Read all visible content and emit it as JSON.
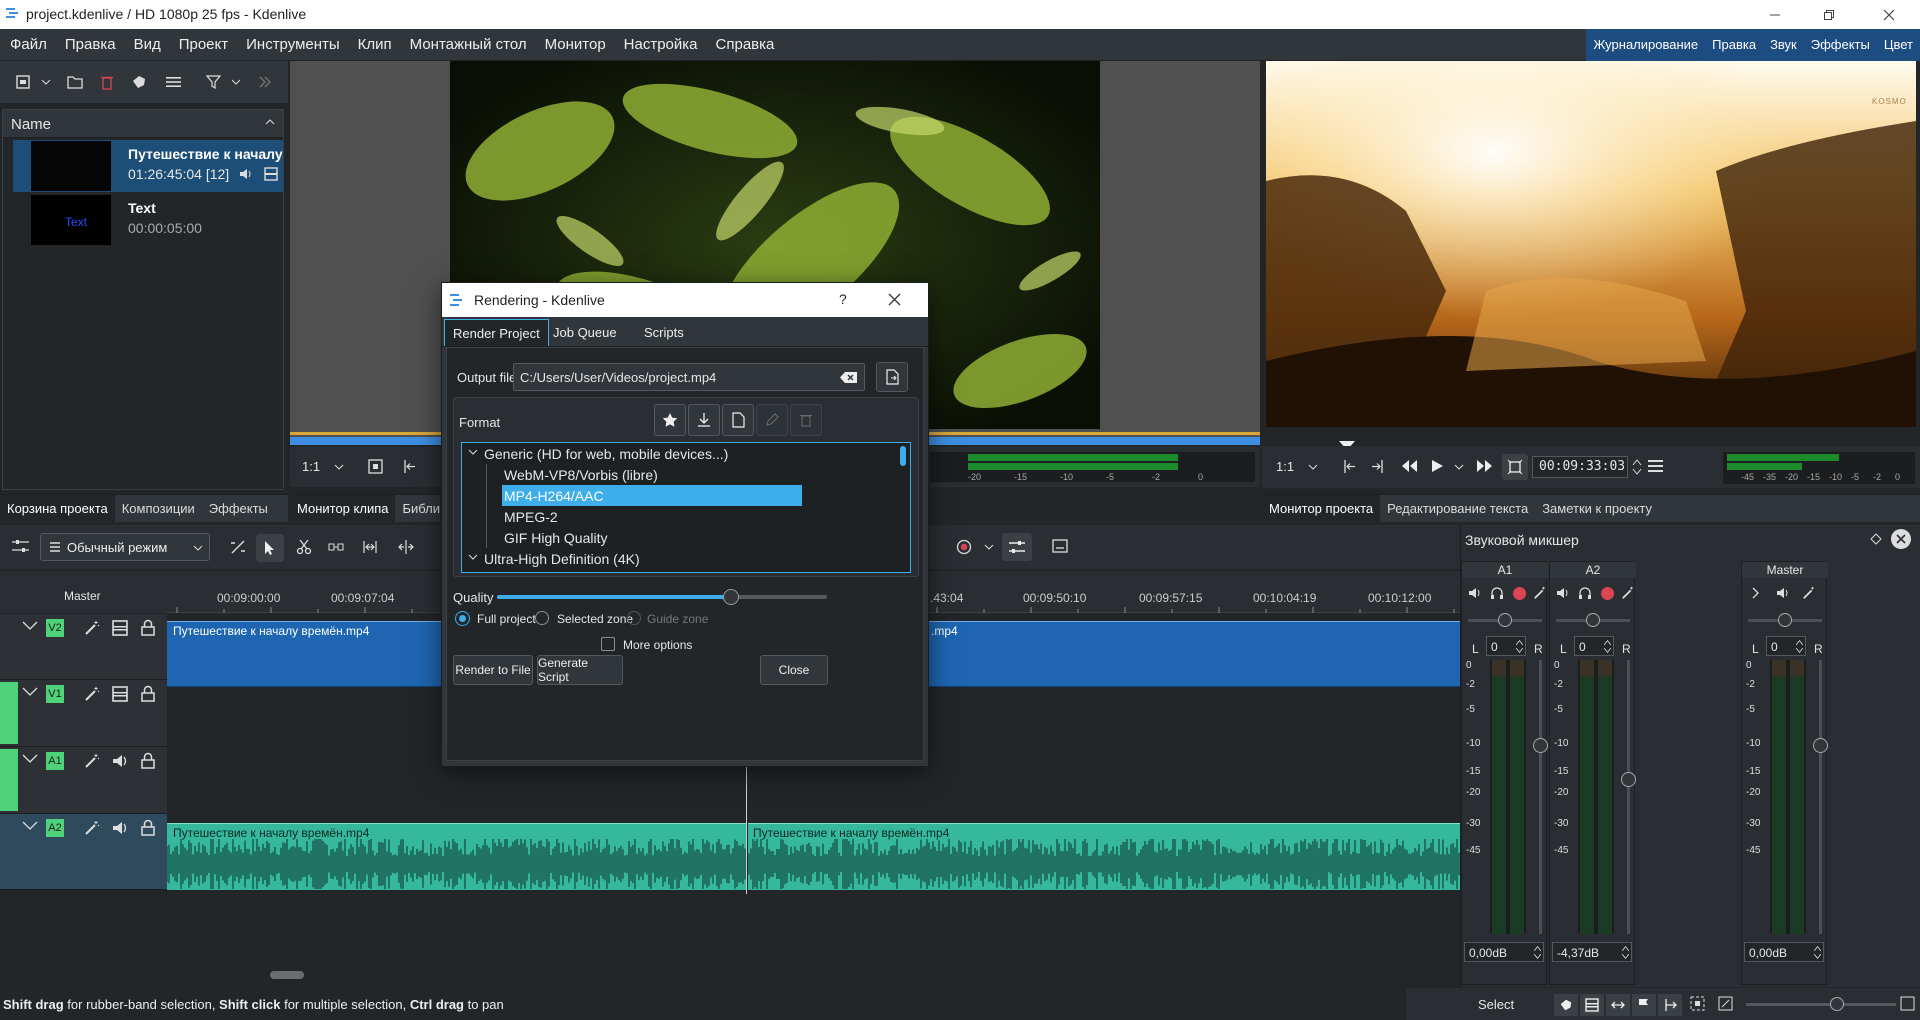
{
  "window": {
    "title": "project.kdenlive / HD 1080p 25 fps - Kdenlive"
  },
  "menu": [
    "Файл",
    "Правка",
    "Вид",
    "Проект",
    "Инструменты",
    "Клип",
    "Монтажный стол",
    "Монитор",
    "Настройка",
    "Справка"
  ],
  "layouts": [
    "Журналирование",
    "Правка",
    "Звук",
    "Эффекты",
    "Цвет"
  ],
  "bin": {
    "header": "Name",
    "items": [
      {
        "title": "Путешествие к началу",
        "meta": "01:26:45:04 [12]"
      },
      {
        "title": "Text",
        "meta": "00:00:05:00",
        "thumb_text": "Text"
      }
    ],
    "tabs": [
      "Корзина проекта",
      "Композиции",
      "Эффекты"
    ]
  },
  "clip_monitor": {
    "zoom": "1:1",
    "tabs": [
      "Монитор клипа",
      "Библи"
    ]
  },
  "project_monitor": {
    "zoom": "1:1",
    "timecode": "00:09:33:03",
    "watermark": "KOSMO",
    "meter_labels": [
      "-45",
      "-35",
      "-20",
      "-15",
      "-10",
      "-5",
      "-2",
      "0"
    ],
    "tabs": [
      "Монитор проекта",
      "Редактирование текста",
      "Заметки к проекту"
    ]
  },
  "clip_meter_labels": [
    "-20",
    "-15",
    "-10",
    "-5",
    "-2",
    "0"
  ],
  "timeline": {
    "mode": "Обычный режим",
    "master_label": "Master",
    "ruler_left": [
      "00:09:00:00",
      "00:09:07:04"
    ],
    "ruler_right": [
      ".43:04",
      "00:09:50:10",
      "00:09:57:15",
      "00:10:04:19",
      "00:10:12:00"
    ],
    "tracks": [
      {
        "name": "V2"
      },
      {
        "name": "V1"
      },
      {
        "name": "A1"
      },
      {
        "name": "A2"
      }
    ],
    "clips": {
      "v2_left": "Путешествие к началу времён.mp4",
      "v2_right": ".mp4",
      "a2_left": "Путешествие к началу времён.mp4",
      "a2_right": "Путешествие к началу времён.mp4"
    }
  },
  "dialog": {
    "title": "Rendering - Kdenlive",
    "help": "?",
    "tabs": [
      "Render Project",
      "Job Queue",
      "Scripts"
    ],
    "output_label": "Output file",
    "output_value": "C:/Users/User/Videos/project.mp4",
    "format_label": "Format",
    "groups": [
      {
        "name": "Generic (HD for web, mobile devices...)",
        "items": [
          "WebM-VP8/Vorbis (libre)",
          "MP4-H264/AAC",
          "MPEG-2",
          "GIF High Quality"
        ],
        "selected": 1
      },
      {
        "name": "Ultra-High Definition (4K)"
      }
    ],
    "quality_label": "Quality",
    "quality_value": 0.71,
    "zones": [
      "Full project",
      "Selected zone",
      "Guide zone"
    ],
    "more_options": "More options",
    "buttons": [
      "Render to File",
      "Generate Script",
      "Close"
    ]
  },
  "mixer": {
    "title": "Звуковой микшер",
    "channels": [
      {
        "name": "A1",
        "pan": "0",
        "db": "0,00dB"
      },
      {
        "name": "A2",
        "pan": "0",
        "db": "-4,37dB"
      },
      {
        "name": "Master",
        "pan": "0",
        "db": "0,00dB"
      }
    ],
    "lr": [
      "L",
      "R"
    ],
    "scale": [
      "0",
      "-2",
      "-5",
      "-10",
      "-15",
      "-20",
      "-30",
      "-45"
    ]
  },
  "status": {
    "parts": [
      {
        "b": "Shift drag"
      },
      {
        "t": " for rubber-band selection, "
      },
      {
        "b": "Shift click"
      },
      {
        "t": " for multiple selection, "
      },
      {
        "b": "Ctrl drag"
      },
      {
        "t": " to pan"
      }
    ],
    "tool": "Select"
  },
  "colors": {
    "accent": "#3daee9",
    "selection": "#3daee9",
    "video_clip": "#1e66b2",
    "audio_clip": "#35b89b",
    "track_active": "#4fd37a",
    "record": "#da4453"
  }
}
